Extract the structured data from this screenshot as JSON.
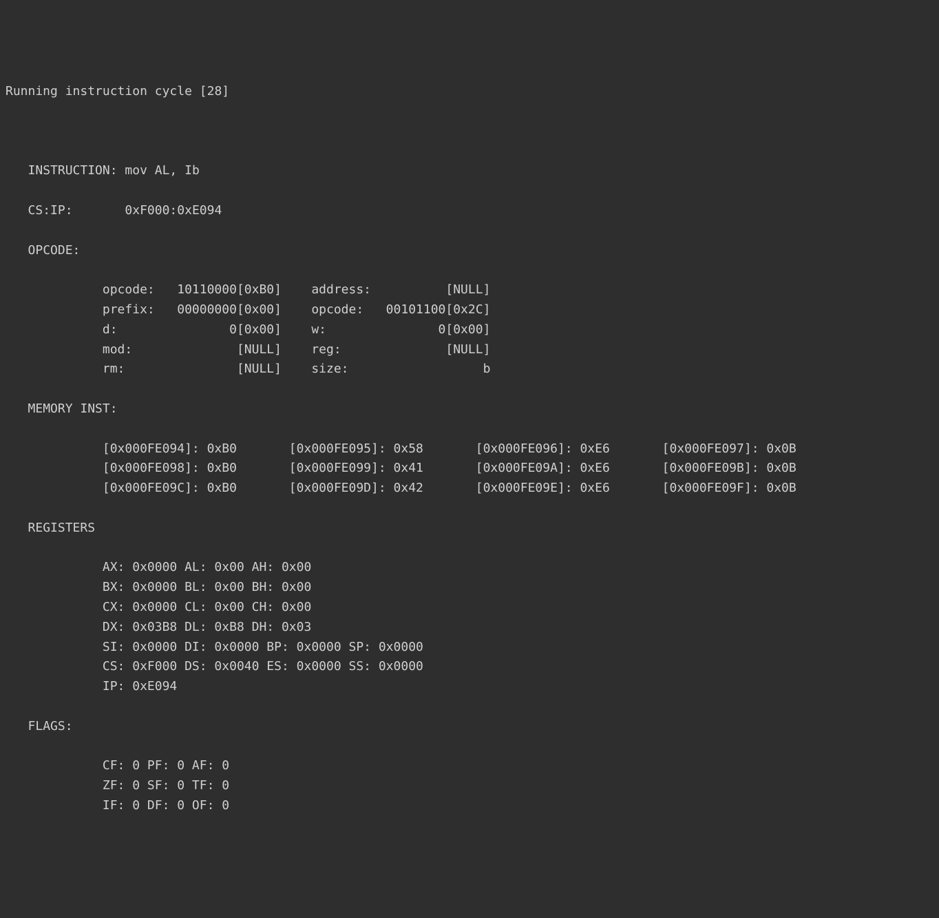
{
  "header": {
    "prefix": "Running instruction cycle [",
    "cycle": "28",
    "suffix": "]"
  },
  "instruction": {
    "label": "INSTRUCTION:",
    "value": "mov AL, Ib"
  },
  "csip": {
    "label": "CS:IP:",
    "value": "0xF000:0xE094"
  },
  "opcode": {
    "label": "OPCODE:",
    "left": [
      {
        "name": "opcode:",
        "value": "10110000[0xB0]"
      },
      {
        "name": "prefix:",
        "value": "00000000[0x00]"
      },
      {
        "name": "d:",
        "value": "0[0x00]"
      },
      {
        "name": "mod:",
        "value": "[NULL]"
      },
      {
        "name": "rm:",
        "value": "[NULL]"
      }
    ],
    "right": [
      {
        "name": "address:",
        "value": "[NULL]"
      },
      {
        "name": "opcode:",
        "value": "00101100[0x2C]"
      },
      {
        "name": "w:",
        "value": "0[0x00]"
      },
      {
        "name": "reg:",
        "value": "[NULL]"
      },
      {
        "name": "size:",
        "value": "b"
      }
    ]
  },
  "memory": {
    "label": "MEMORY INST:",
    "rows": [
      [
        {
          "addr": "[0x000FE094]:",
          "val": "0xB0"
        },
        {
          "addr": "[0x000FE095]:",
          "val": "0x58"
        },
        {
          "addr": "[0x000FE096]:",
          "val": "0xE6"
        },
        {
          "addr": "[0x000FE097]:",
          "val": "0x0B"
        }
      ],
      [
        {
          "addr": "[0x000FE098]:",
          "val": "0xB0"
        },
        {
          "addr": "[0x000FE099]:",
          "val": "0x41"
        },
        {
          "addr": "[0x000FE09A]:",
          "val": "0xE6"
        },
        {
          "addr": "[0x000FE09B]:",
          "val": "0x0B"
        }
      ],
      [
        {
          "addr": "[0x000FE09C]:",
          "val": "0xB0"
        },
        {
          "addr": "[0x000FE09D]:",
          "val": "0x42"
        },
        {
          "addr": "[0x000FE09E]:",
          "val": "0xE6"
        },
        {
          "addr": "[0x000FE09F]:",
          "val": "0x0B"
        }
      ]
    ]
  },
  "registers": {
    "label": "REGISTERS",
    "lines": [
      "AX: 0x0000 AL: 0x00 AH: 0x00",
      "BX: 0x0000 BL: 0x00 BH: 0x00",
      "CX: 0x0000 CL: 0x00 CH: 0x00",
      "DX: 0x03B8 DL: 0xB8 DH: 0x03",
      "SI: 0x0000 DI: 0x0000 BP: 0x0000 SP: 0x0000",
      "CS: 0xF000 DS: 0x0040 ES: 0x0000 SS: 0x0000",
      "IP: 0xE094"
    ]
  },
  "flags": {
    "label": "FLAGS:",
    "lines": [
      "CF: 0 PF: 0 AF: 0",
      "ZF: 0 SF: 0 TF: 0",
      "IF: 0 DF: 0 OF: 0"
    ]
  }
}
